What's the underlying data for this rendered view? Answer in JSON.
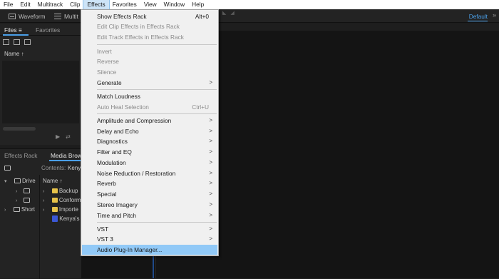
{
  "menubar": {
    "items": [
      "File",
      "Edit",
      "Multitrack",
      "Clip",
      "Effects",
      "Favorites",
      "View",
      "Window",
      "Help"
    ],
    "active": "Effects"
  },
  "toolbar": {
    "waveform_label": "Waveform",
    "multitrack_label": "Multit",
    "workspace_label": "Default"
  },
  "files_panel": {
    "tabs": [
      "Files",
      "Favorites"
    ],
    "menu_icon": "≡",
    "column_header": "Name ↑"
  },
  "media_panel": {
    "tabs": [
      "Effects Rack",
      "Media Brow"
    ],
    "contents_label": "Contents:",
    "contents_value": "Kenya",
    "left_items": [
      "Drive",
      "",
      "",
      "Short"
    ],
    "column_header": "Name ↑",
    "right_items": [
      "Backup",
      "Conform",
      "Importe",
      "Kenya's"
    ]
  },
  "effects_menu": {
    "show_rack": "Show Effects Rack",
    "show_rack_shortcut": "Alt+0",
    "edit_clip": "Edit Clip Effects in Effects Rack",
    "edit_track": "Edit Track Effects in Effects Rack",
    "invert": "Invert",
    "reverse": "Reverse",
    "silence": "Silence",
    "generate": "Generate",
    "match_loudness": "Match Loudness",
    "auto_heal": "Auto Heal Selection",
    "auto_heal_shortcut": "Ctrl+U",
    "amplitude": "Amplitude and Compression",
    "delay": "Delay and Echo",
    "diagnostics": "Diagnostics",
    "filter": "Filter and EQ",
    "modulation": "Modulation",
    "noise": "Noise Reduction / Restoration",
    "reverb": "Reverb",
    "special": "Special",
    "stereo": "Stereo Imagery",
    "time": "Time and Pitch",
    "vst": "VST",
    "vst3": "VST 3",
    "plugin_manager": "Audio Plug-In Manager..."
  },
  "icons": {
    "submenu": "chevron-right-icon",
    "waveform": "waveform-icon",
    "multitrack": "multitrack-icon"
  },
  "colors": {
    "accent": "#4a9fe8",
    "highlight": "#91c9f7",
    "menu_bg": "#f0f0f0",
    "app_bg": "#1d1d1d"
  }
}
